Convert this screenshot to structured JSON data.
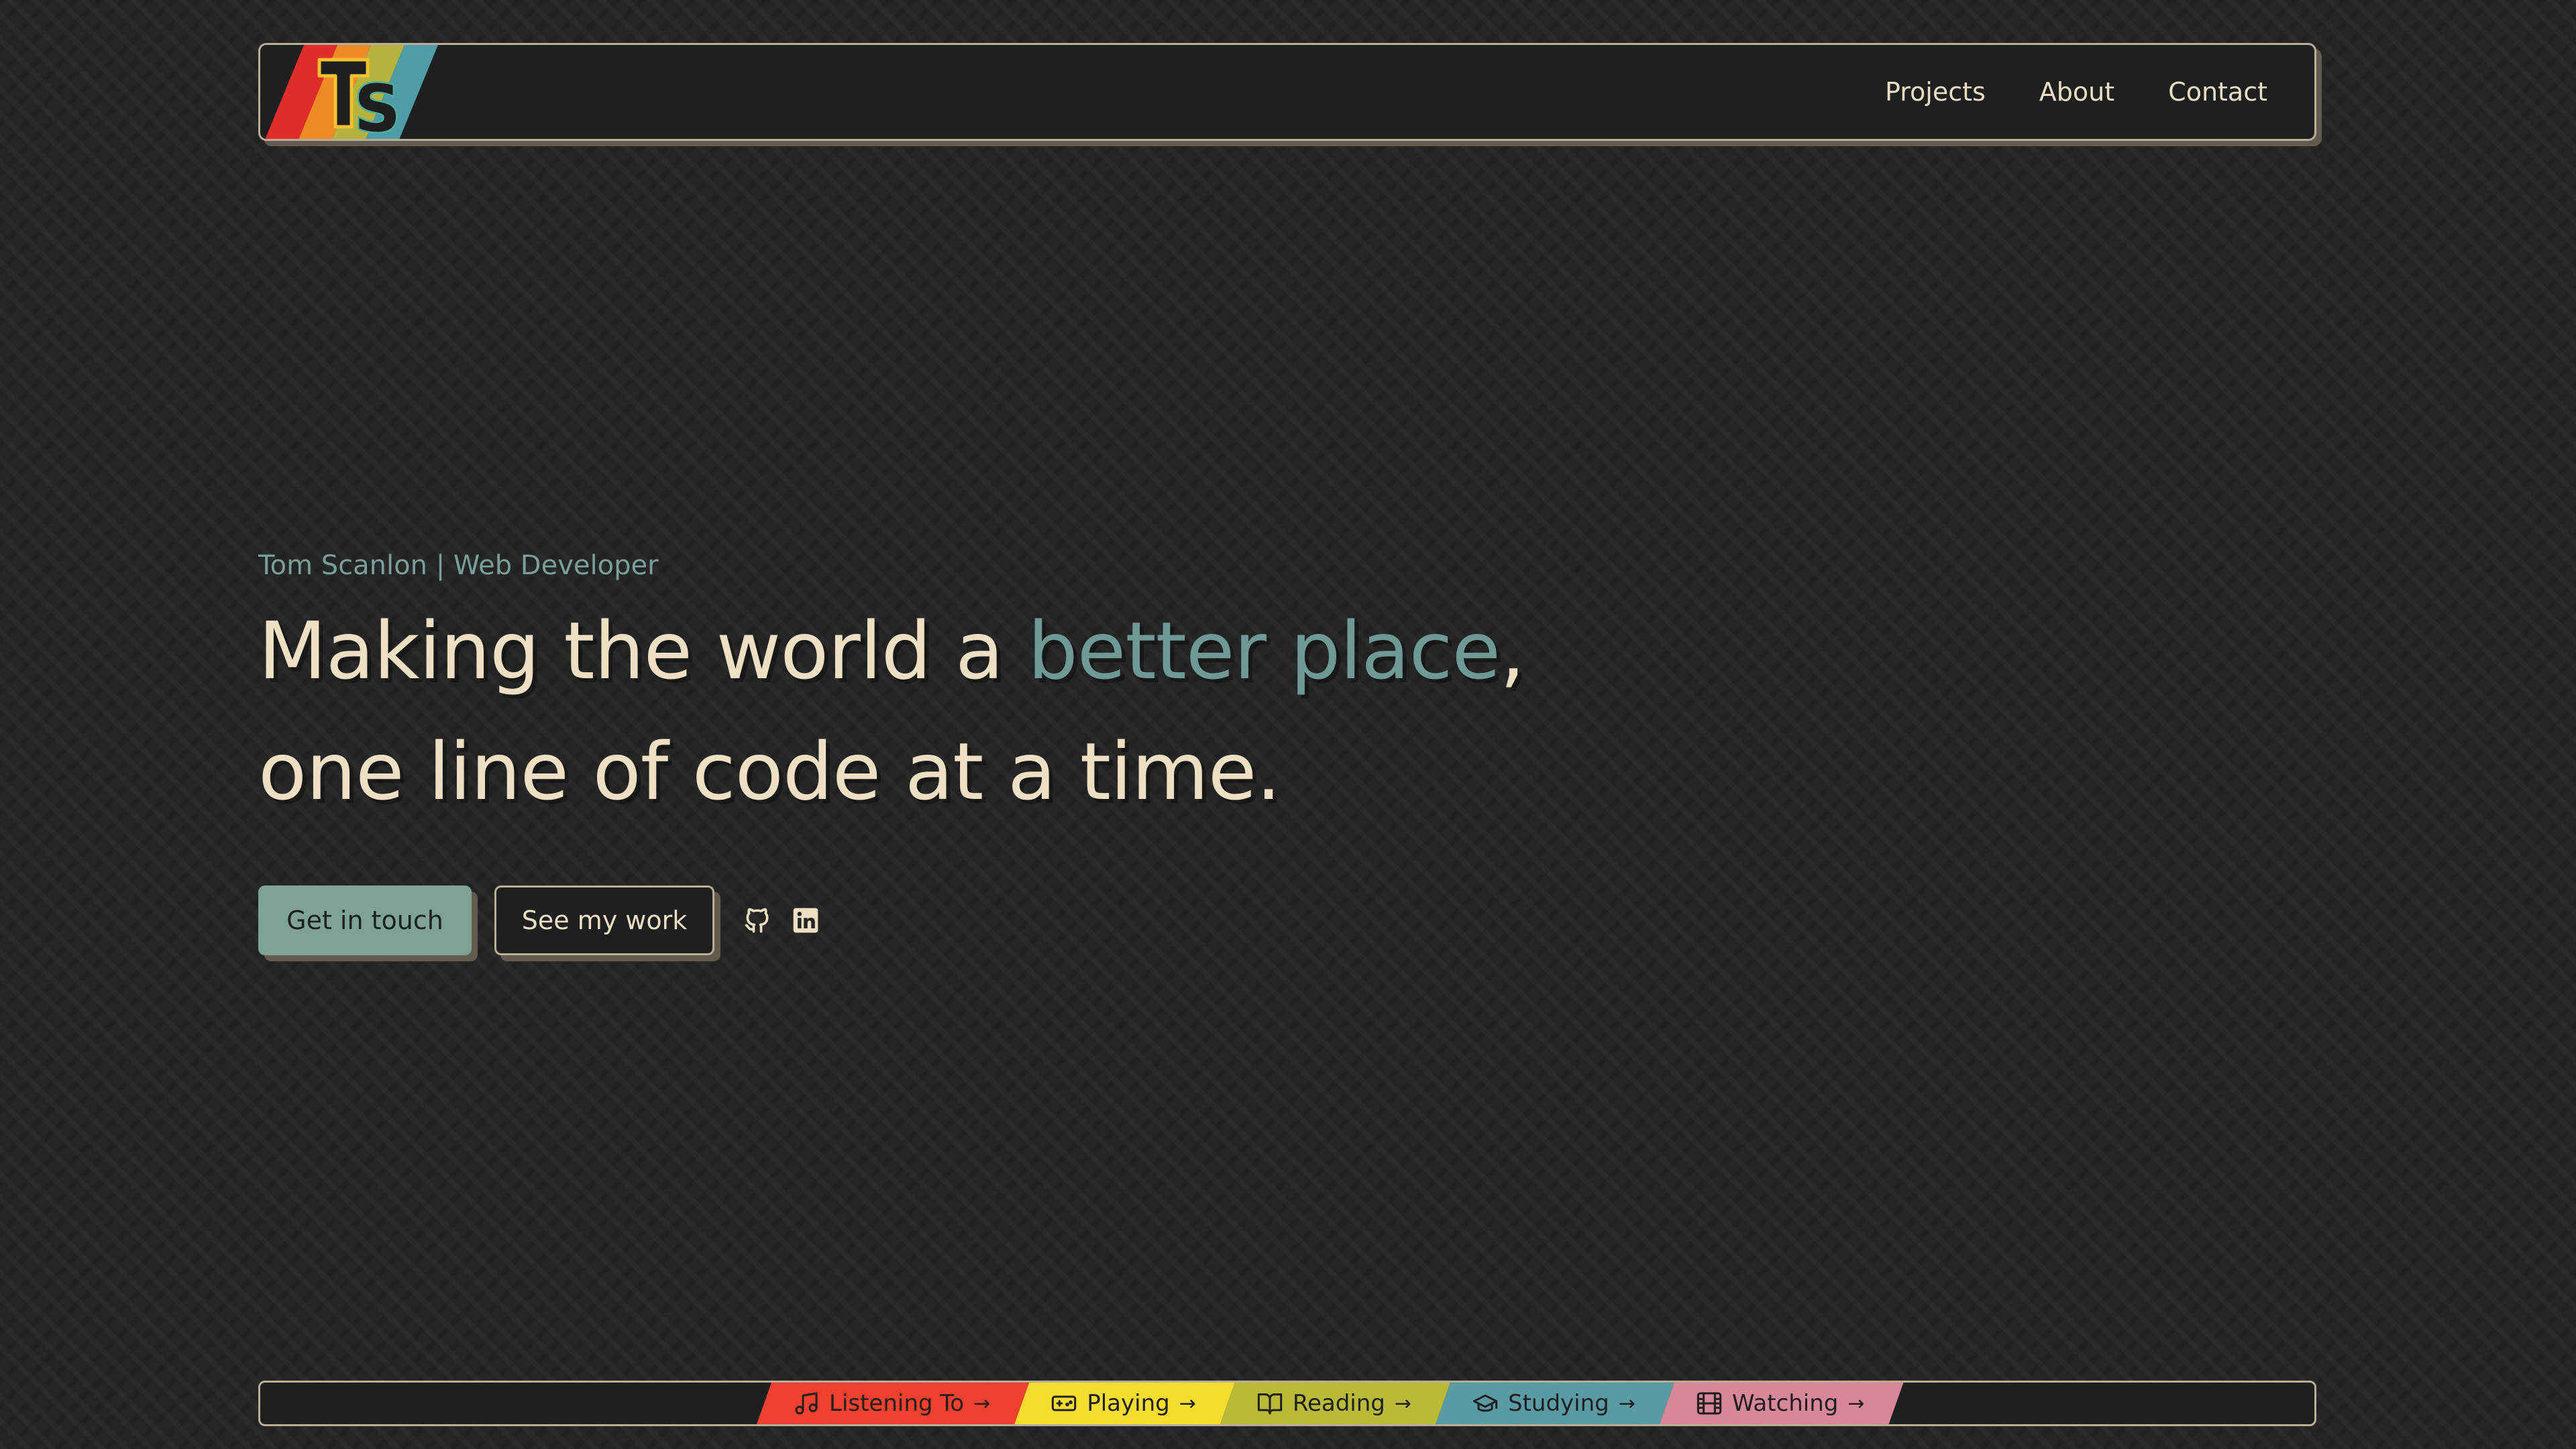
{
  "brand": {
    "logo_text": "TS",
    "stripe_colors": [
      "#e02d2a",
      "#f08a26",
      "#b3b33e",
      "#4d9ca8"
    ]
  },
  "nav": {
    "items": [
      {
        "label": "Projects"
      },
      {
        "label": "About"
      },
      {
        "label": "Contact"
      }
    ]
  },
  "hero": {
    "eyebrow": "Tom Scanlon | Web Developer",
    "line1_prefix": "Making the world a ",
    "line1_accent": "better place",
    "line1_suffix": ",",
    "line2": "one line of code at a time.",
    "accent_color": "#6e9994"
  },
  "cta": {
    "primary_label": "Get in touch",
    "secondary_label": "See my work"
  },
  "social": {
    "icons": [
      "github-icon",
      "linkedin-icon"
    ]
  },
  "status_bar": {
    "chips": [
      {
        "label": "Listening To",
        "icon": "music-note-icon",
        "color": "#f0412f",
        "arrow": "→"
      },
      {
        "label": "Playing",
        "icon": "gamepad-icon",
        "color": "#f4dd2e",
        "arrow": "→"
      },
      {
        "label": "Reading",
        "icon": "book-icon",
        "color": "#b8ba38",
        "arrow": "→"
      },
      {
        "label": "Studying",
        "icon": "graduation-cap-icon",
        "color": "#5a9ba3",
        "arrow": "→"
      },
      {
        "label": "Watching",
        "icon": "film-icon",
        "color": "#d8869a",
        "arrow": "→"
      }
    ]
  }
}
